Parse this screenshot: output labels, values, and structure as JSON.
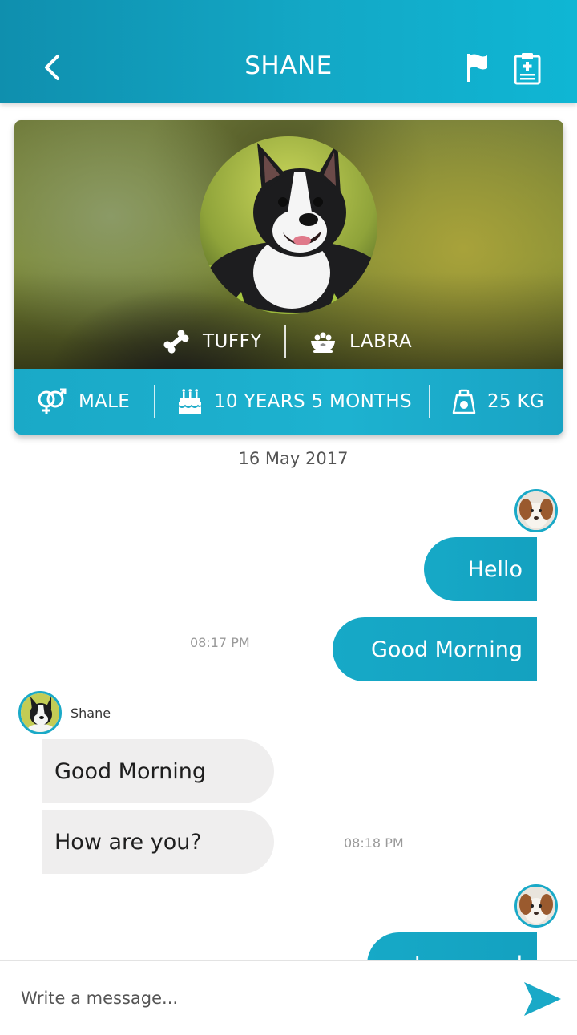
{
  "header": {
    "title": "SHANE"
  },
  "pet": {
    "name": "TUFFY",
    "breed": "LABRA",
    "gender": "MALE",
    "age": "10 YEARS 5 MONTHS",
    "weight": "25 KG"
  },
  "chat": {
    "date": "16 May 2017",
    "messages_out_1": [
      "Hello",
      "Good Morning"
    ],
    "time_out_1": "08:17 PM",
    "sender_name": "Shane",
    "messages_in_1": [
      "Good Morning",
      "How are you?"
    ],
    "time_in_1": "08:18 PM",
    "messages_out_2": [
      "I am good"
    ]
  },
  "composer": {
    "placeholder": "Write a message..."
  },
  "icons": {
    "back": "chevron-left-icon",
    "flag": "flag-icon",
    "report": "medical-clipboard-icon",
    "name": "bone-icon",
    "breed": "pet-bowl-icon",
    "gender": "gender-icon",
    "age": "birthday-cake-icon",
    "weight": "weight-scale-icon",
    "send": "send-icon"
  },
  "colors": {
    "accent": "#1aa9c7",
    "header_start": "#0f8fae",
    "header_end": "#0fb6d4",
    "bubble_in": "#efeeee"
  }
}
